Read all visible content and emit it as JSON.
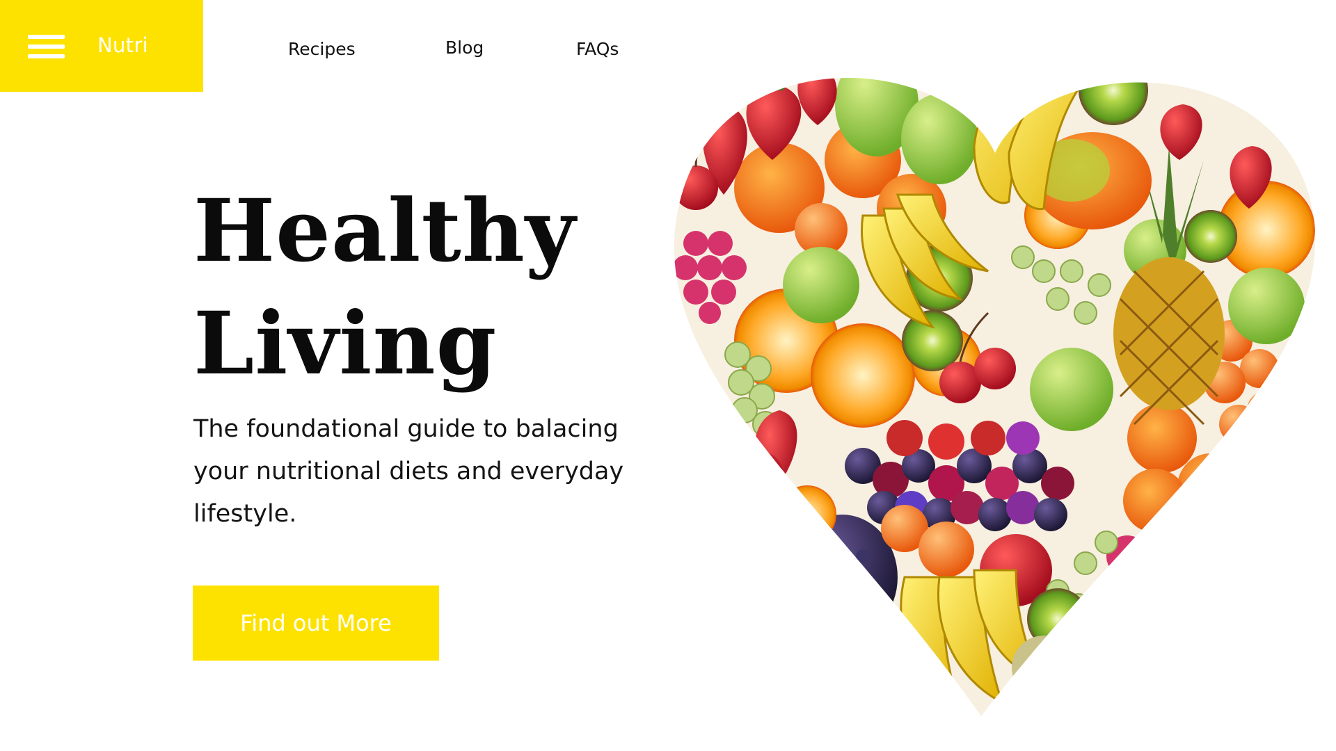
{
  "header": {
    "brand": "Nutri",
    "menu_icon": "hamburger-menu-icon",
    "accent_color": "#fde200",
    "nav": [
      {
        "label": "Recipes"
      },
      {
        "label": "Blog"
      },
      {
        "label": "FAQs"
      }
    ]
  },
  "hero": {
    "title_line1": "Healthy",
    "title_line2": "Living",
    "subtitle": "The foundational guide to balacing your nutritional diets and everyday lifestyle.",
    "cta_label": "Find out More",
    "image": "fruit-heart-image"
  }
}
